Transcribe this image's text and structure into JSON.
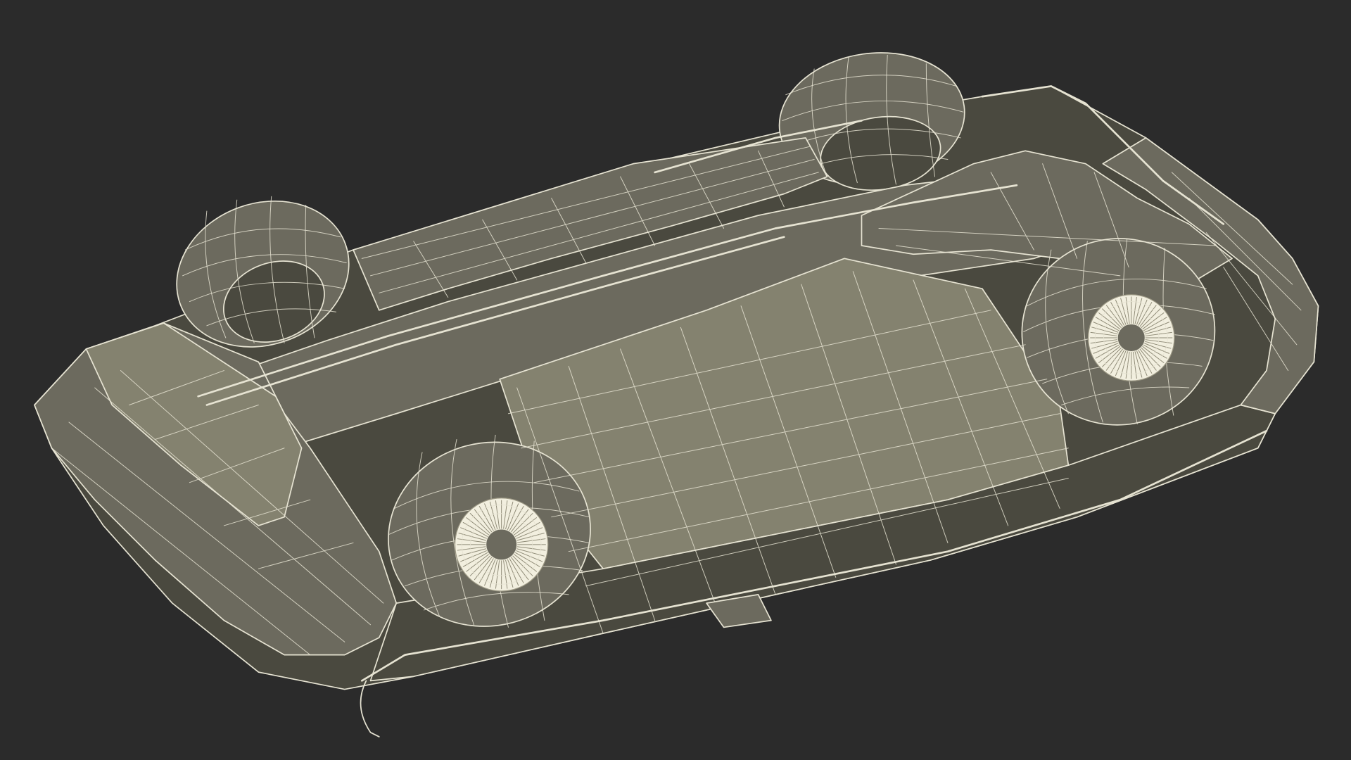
{
  "scene": {
    "subject": "wireframe-render-of-upside-down-car-underside",
    "colors": {
      "background": "#2b2b2b",
      "fill": "#6c6a5e",
      "fill_dark": "#4a493f",
      "fill_light": "#84826f",
      "wire": "#e6e3d2",
      "rim": "#f2efdf"
    }
  }
}
